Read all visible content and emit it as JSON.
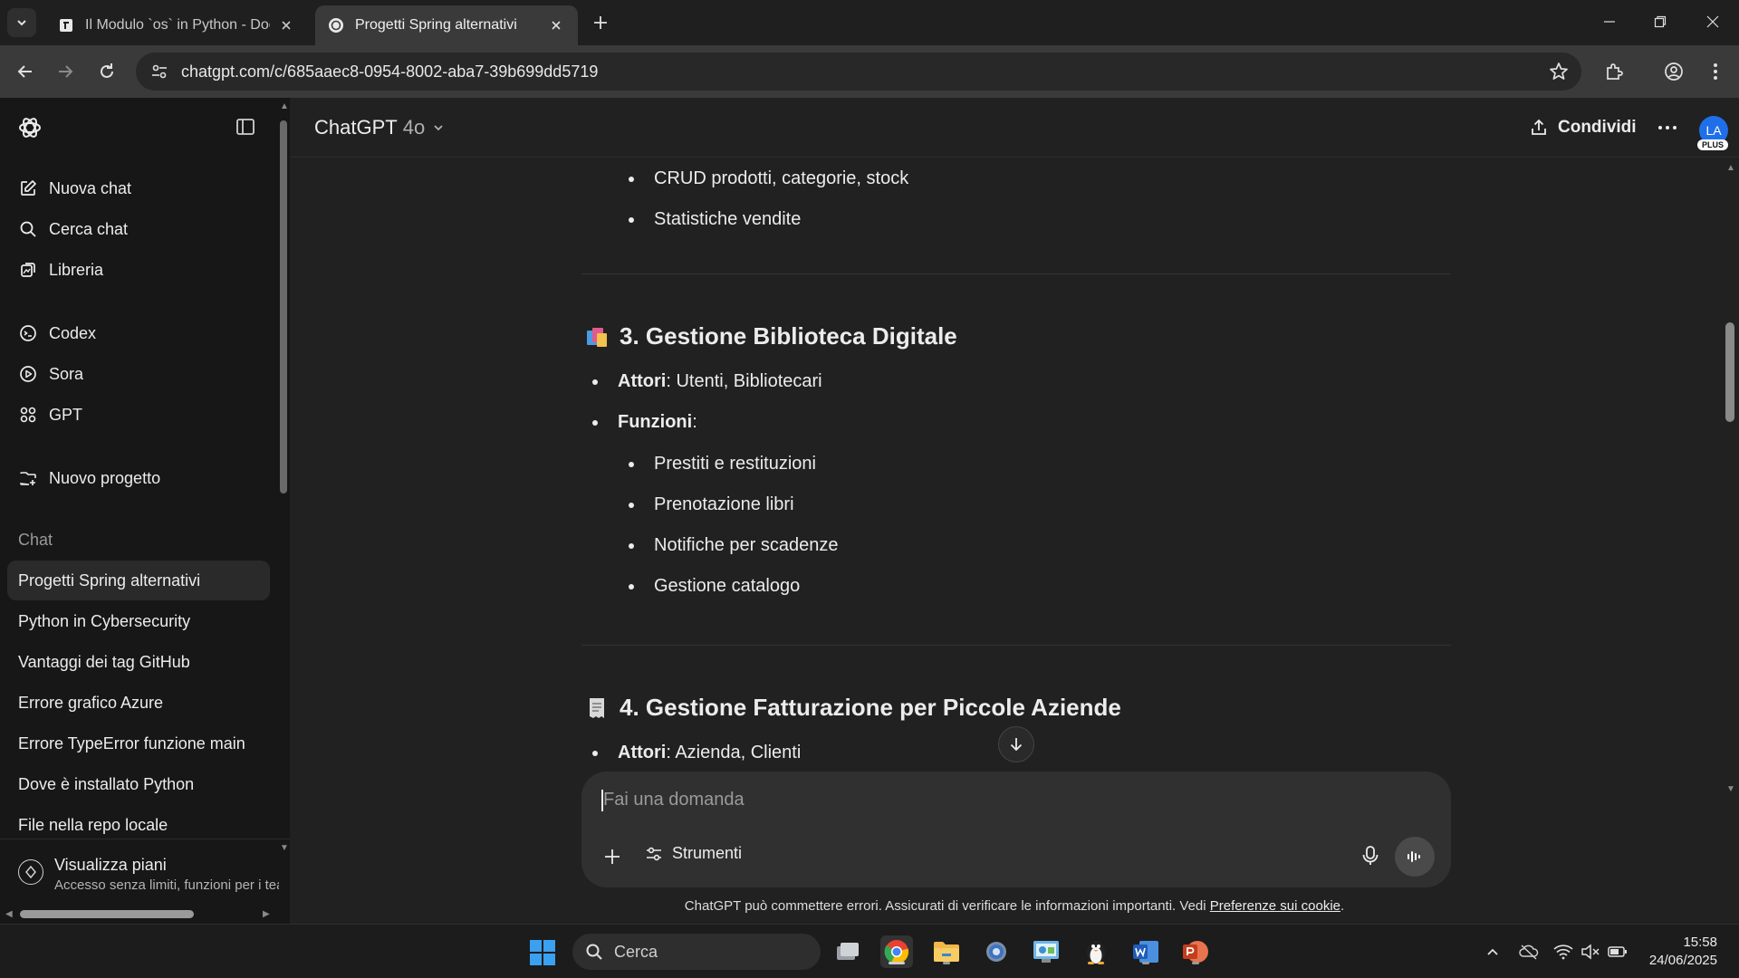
{
  "browser": {
    "tabs": [
      {
        "title": "Il Modulo `os` in Python - Docu"
      },
      {
        "title": "Progetti Spring alternativi"
      }
    ],
    "url": "chatgpt.com/c/685aaec8-0954-8002-aba7-39b699dd5719"
  },
  "sidebar": {
    "top_items": [
      {
        "label": "Nuova chat",
        "icon": "edit-icon"
      },
      {
        "label": "Cerca chat",
        "icon": "search-icon"
      },
      {
        "label": "Libreria",
        "icon": "library-icon"
      }
    ],
    "tools": [
      {
        "label": "Codex",
        "icon": "codex-icon"
      },
      {
        "label": "Sora",
        "icon": "play-icon"
      },
      {
        "label": "GPT",
        "icon": "grid-icon"
      }
    ],
    "new_project": "Nuovo progetto",
    "section_label": "Chat",
    "chats": [
      "Progetti Spring alternativi",
      "Python in Cybersecurity",
      "Vantaggi dei tag GitHub",
      "Errore grafico Azure",
      "Errore TypeError funzione main",
      "Dove è installato Python",
      "File nella repo locale"
    ],
    "plans_title": "Visualizza piani",
    "plans_subtitle": "Accesso senza limiti, funzioni per i tea"
  },
  "header": {
    "model_name": "ChatGPT",
    "model_version": "4o",
    "share_label": "Condividi",
    "avatar_initials": "LA",
    "plan_badge": "PLUS"
  },
  "content": {
    "section2_sub": [
      "CRUD prodotti, categorie, stock",
      "Statistiche vendite"
    ],
    "section3": {
      "title": "3. Gestione Biblioteca Digitale",
      "actors_label": "Attori",
      "actors_value": ": Utenti, Bibliotecari",
      "functions_label": "Funzioni",
      "functions_suffix": ":",
      "functions": [
        "Prestiti e restituzioni",
        "Prenotazione libri",
        "Notifiche per scadenze",
        "Gestione catalogo"
      ]
    },
    "section4": {
      "title": "4. Gestione Fatturazione per Piccole Aziende",
      "actors_label": "Attori",
      "actors_value": ": Azienda, Clienti"
    }
  },
  "composer": {
    "placeholder": "Fai una domanda",
    "tools_label": "Strumenti"
  },
  "disclaimer": {
    "text": "ChatGPT può commettere errori. Assicurati di verificare le informazioni importanti. Vedi ",
    "link": "Preferenze sui cookie",
    "end": "."
  },
  "taskbar": {
    "search_label": "Cerca",
    "time": "15:58",
    "date": "24/06/2025"
  }
}
